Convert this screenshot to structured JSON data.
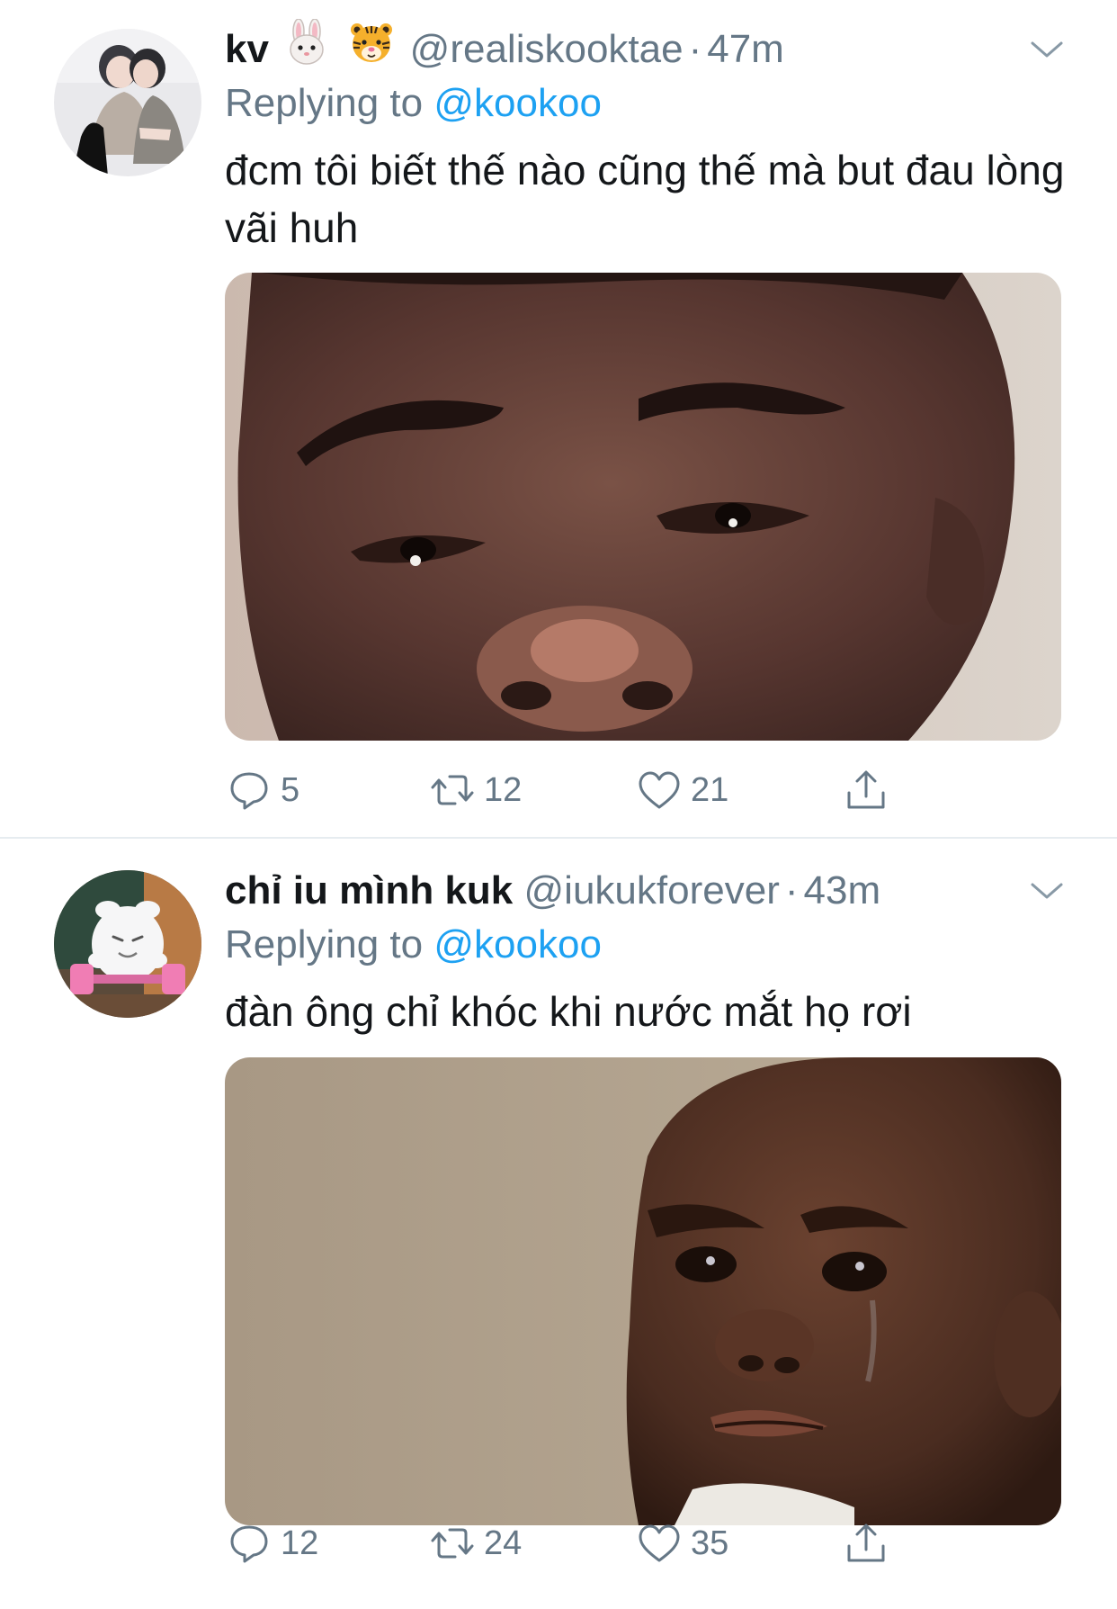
{
  "tweets": [
    {
      "display_name": "kv",
      "emojis": [
        "rabbit-face",
        "tiger-face"
      ],
      "handle": "@realiskooktae",
      "separator": "·",
      "time": "47m",
      "replying_label": "Replying to",
      "replying_to": "@kookoo",
      "text": "đcm tôi biết thế nào cũng thế mà but đau lòng vãi huh",
      "stats": {
        "replies": "5",
        "retweets": "12",
        "likes": "21"
      }
    },
    {
      "display_name": "chỉ iu mình kuk",
      "handle": "@iukukforever",
      "separator": "·",
      "time": "43m",
      "replying_label": "Replying to",
      "replying_to": "@kookoo",
      "text": "đàn ông chỉ khóc khi nước mắt họ rơi",
      "stats": {
        "replies": "12",
        "retweets": "24",
        "likes": "35"
      }
    }
  ],
  "icons": [
    "chevron-down-icon",
    "reply-icon",
    "retweet-icon",
    "like-icon",
    "share-icon"
  ],
  "colors": {
    "link": "#1da1f2",
    "secondary": "#657786",
    "text": "#14171a",
    "divider": "#e6ecf0"
  }
}
